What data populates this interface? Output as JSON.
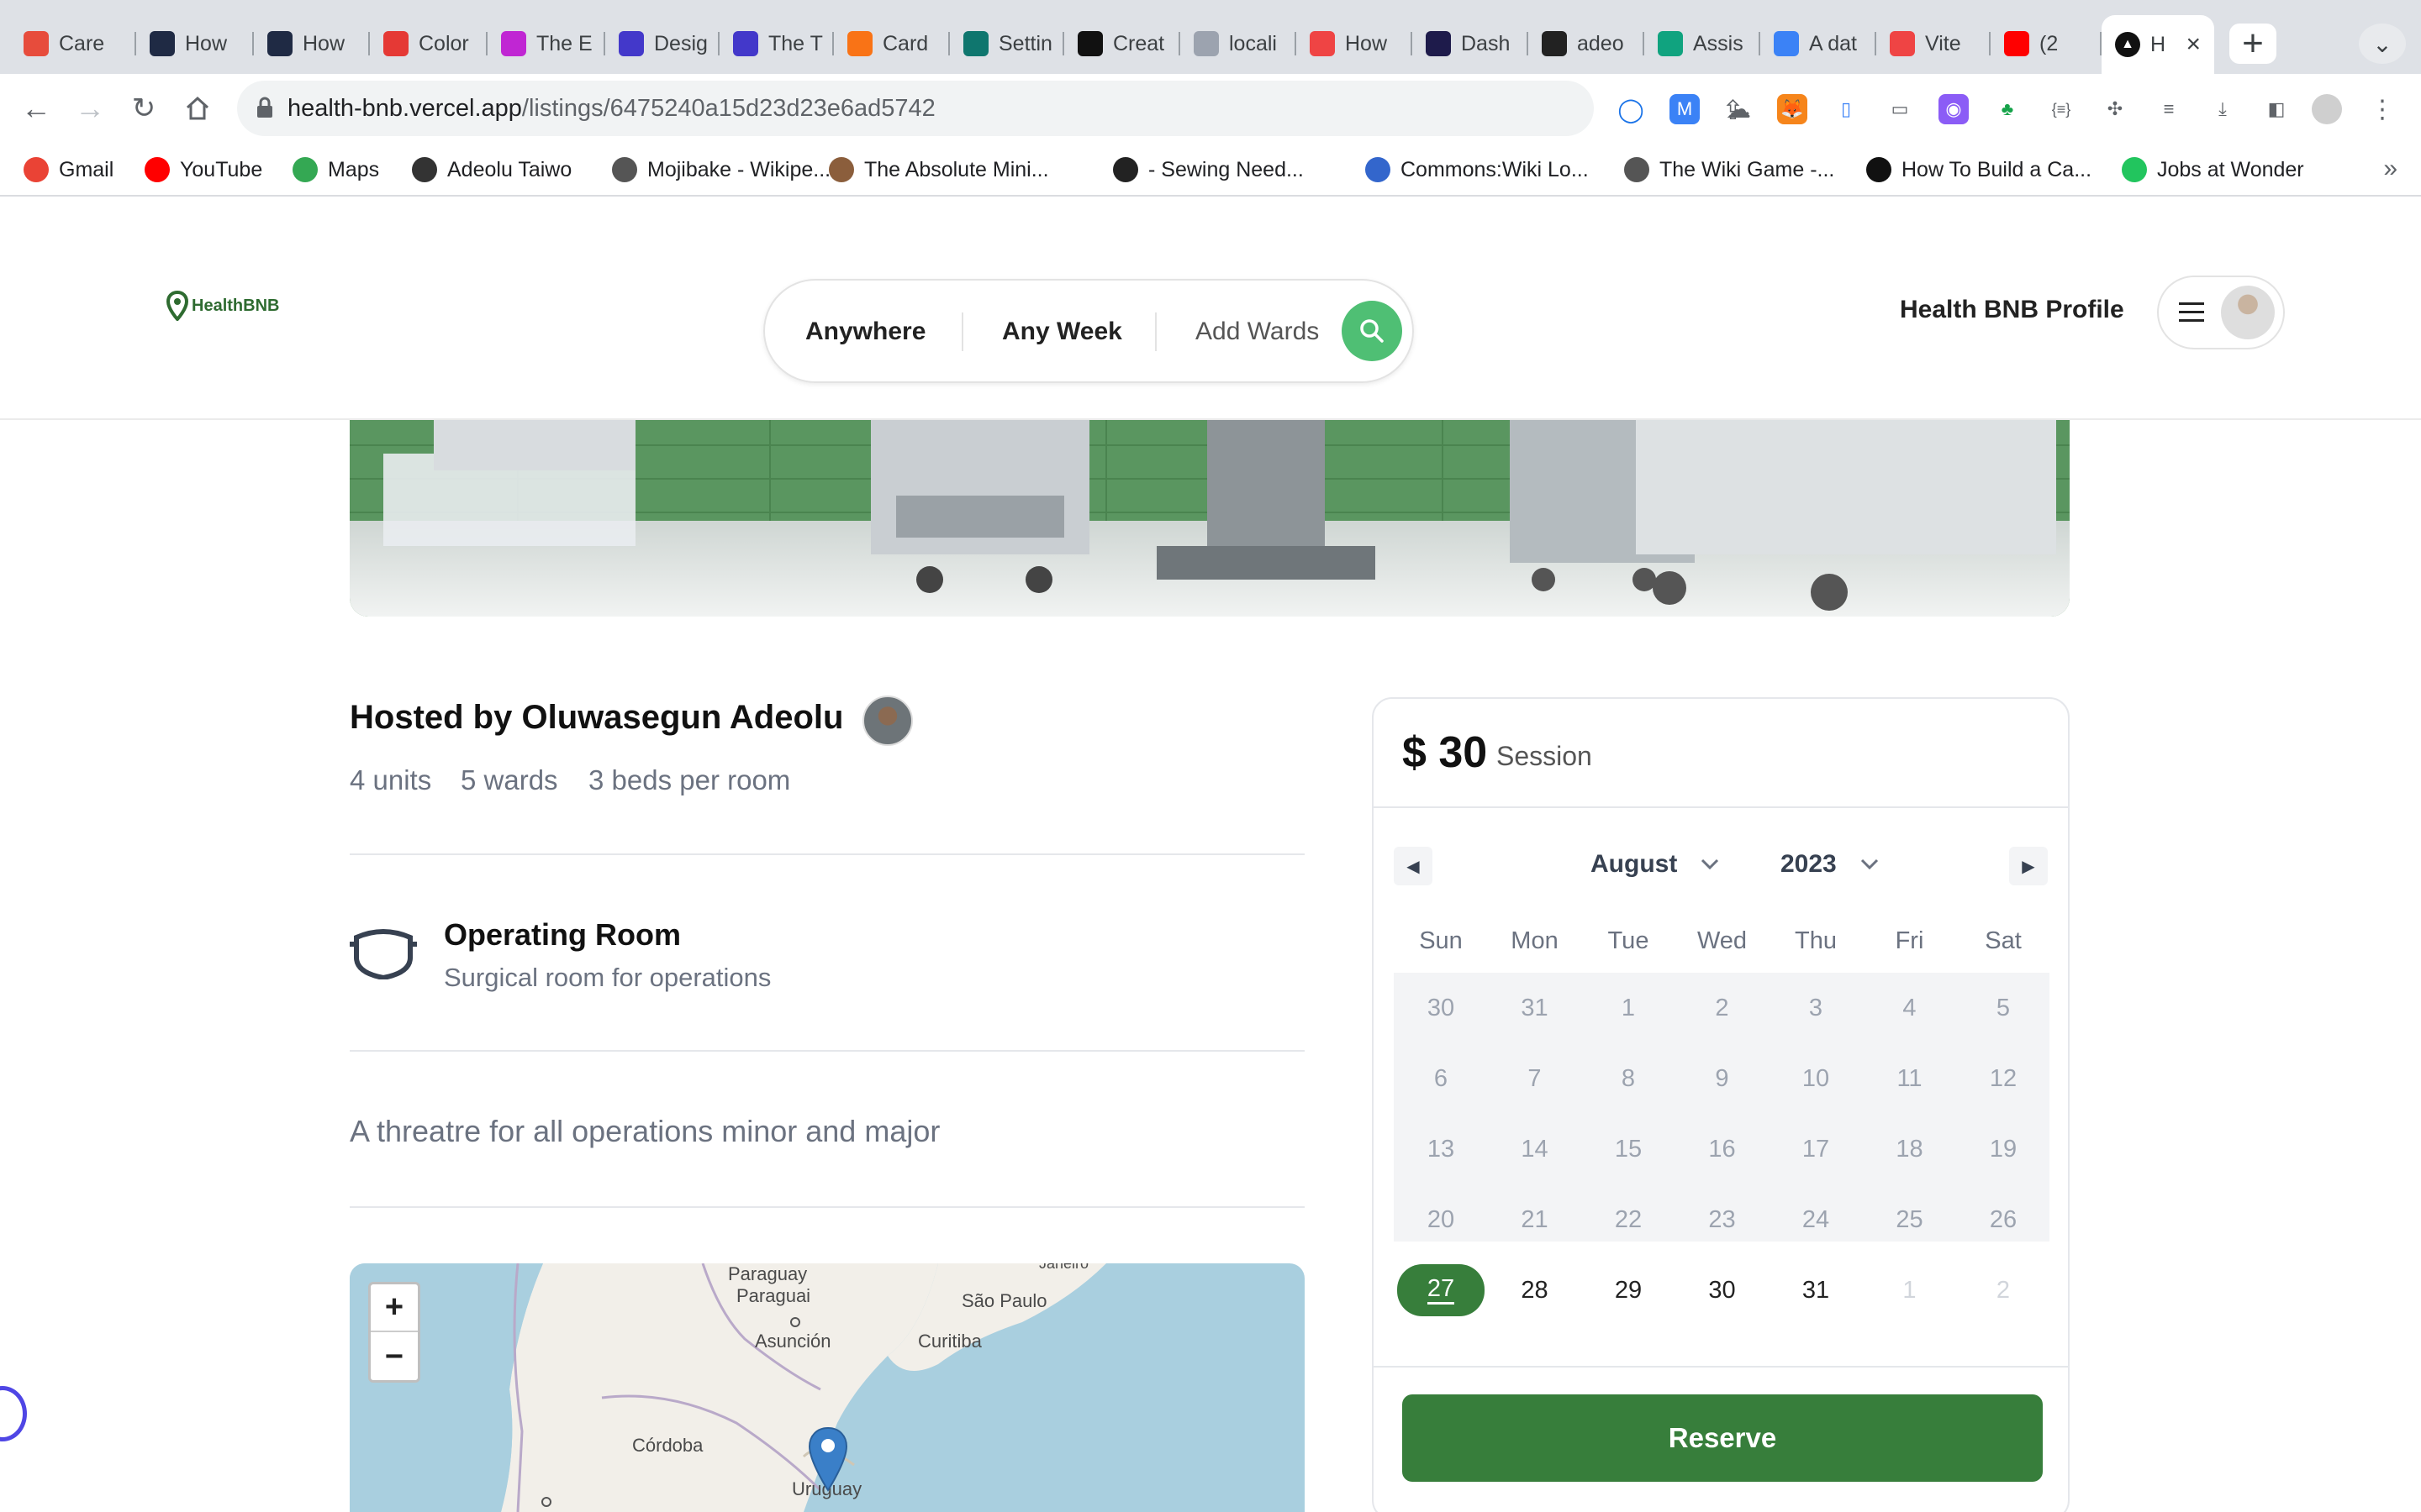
{
  "browser": {
    "tabs": [
      {
        "title": "Care",
        "icon_color": "#e74c3c"
      },
      {
        "title": "How",
        "icon_color": "#1f2a44"
      },
      {
        "title": "How",
        "icon_color": "#1f2a44"
      },
      {
        "title": "Color",
        "icon_color": "#e53935"
      },
      {
        "title": "The E",
        "icon_color": "#c026d3"
      },
      {
        "title": "Desig",
        "icon_color": "#4338ca"
      },
      {
        "title": "The T",
        "icon_color": "#4338ca"
      },
      {
        "title": "Card",
        "icon_color": "#f97316"
      },
      {
        "title": "Settin",
        "icon_color": "#0f766e"
      },
      {
        "title": "Creat",
        "icon_color": "#111111"
      },
      {
        "title": "locali",
        "icon_color": "#9ca3af"
      },
      {
        "title": "How",
        "icon_color": "#ef4444"
      },
      {
        "title": "Dash",
        "icon_color": "#1e1b4b"
      },
      {
        "title": "adeo",
        "icon_color": "#222222"
      },
      {
        "title": "Assis",
        "icon_color": "#10a37f"
      },
      {
        "title": "A dat",
        "icon_color": "#3b82f6"
      },
      {
        "title": "Vite",
        "icon_color": "#ef4444"
      },
      {
        "title": "(2",
        "icon_color": "#ff0000"
      }
    ],
    "active_tab": {
      "title": "H"
    },
    "url_host": "health-bnb.vercel.app",
    "url_path": "/listings/6475240a15d23d23e6ad5742",
    "bookmarks": [
      {
        "label": "Gmail",
        "icon_color": "#ea4335"
      },
      {
        "label": "YouTube",
        "icon_color": "#ff0000"
      },
      {
        "label": "Maps",
        "icon_color": "#34a853"
      },
      {
        "label": "Adeolu Taiwo",
        "icon_color": "#333333"
      },
      {
        "label": "Mojibake - Wikipe...",
        "icon_color": "#555555"
      },
      {
        "label": "The Absolute Mini...",
        "icon_color": "#8b5e3c"
      },
      {
        "label": "- Sewing Need...",
        "icon_color": "#222222"
      },
      {
        "label": "Commons:Wiki Lo...",
        "icon_color": "#3366cc"
      },
      {
        "label": "The Wiki Game -...",
        "icon_color": "#555555"
      },
      {
        "label": "How To Build a Ca...",
        "icon_color": "#111111"
      },
      {
        "label": "Jobs at Wonder",
        "icon_color": "#22c55e"
      }
    ]
  },
  "header": {
    "logo_text": "HealthBNB",
    "search": {
      "anywhere": "Anywhere",
      "any_week": "Any Week",
      "add_wards": "Add Wards"
    },
    "profile_link": "Health BNB Profile"
  },
  "listing": {
    "host_title": "Hosted by Oluwasegun Adeolu",
    "stats": {
      "units": "4 units",
      "wards": "5 wards",
      "beds": "3 beds per room"
    },
    "feature": {
      "title": "Operating Room",
      "description": "Surgical room for operations"
    },
    "description": "A threatre for all operations minor and major"
  },
  "map": {
    "zoom_in": "+",
    "zoom_out": "−",
    "labels": {
      "paraguay": "Paraguay",
      "paraguai": "Paraguai",
      "asuncion": "Asunción",
      "sao_paulo": "São Paulo",
      "curitiba": "Curitiba",
      "cordoba": "Córdoba",
      "uruguay": "Uruguay",
      "janeiro": "Janeiro"
    }
  },
  "booking": {
    "price": "$ 30",
    "price_unit": "Session",
    "month": "August",
    "year": "2023",
    "weekdays": [
      "Sun",
      "Mon",
      "Tue",
      "Wed",
      "Thu",
      "Fri",
      "Sat"
    ],
    "weeks": [
      [
        "30",
        "31",
        "1",
        "2",
        "3",
        "4",
        "5"
      ],
      [
        "6",
        "7",
        "8",
        "9",
        "10",
        "11",
        "12"
      ],
      [
        "13",
        "14",
        "15",
        "16",
        "17",
        "18",
        "19"
      ],
      [
        "20",
        "21",
        "22",
        "23",
        "24",
        "25",
        "26"
      ],
      [
        "27",
        "28",
        "29",
        "30",
        "31",
        "1",
        "2"
      ]
    ],
    "selected_day": "27",
    "reserve_label": "Reserve",
    "accent_color": "#377e3b"
  }
}
